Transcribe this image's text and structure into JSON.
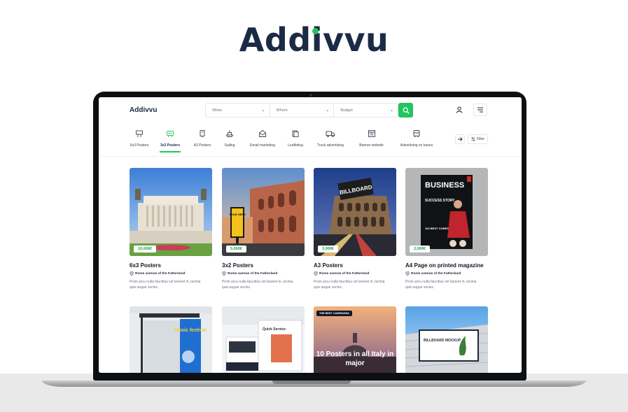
{
  "brand": {
    "name": "Addivvu"
  },
  "header": {
    "logo": "Addivvu",
    "search": {
      "when": "When",
      "where": "Where",
      "budget": "Budget"
    }
  },
  "categories": [
    {
      "label": "6x3 Posters",
      "icon": "billboard-icon"
    },
    {
      "label": "3x2 Posters",
      "icon": "poster-icon",
      "active": true
    },
    {
      "label": "A3 Posters",
      "icon": "a3-poster-icon"
    },
    {
      "label": "Sailing",
      "icon": "boat-icon"
    },
    {
      "label": "Email marketing",
      "icon": "email-icon"
    },
    {
      "label": "Leafleting",
      "icon": "leaflet-icon"
    },
    {
      "label": "Truck advertising",
      "icon": "truck-icon"
    },
    {
      "label": "Banner website",
      "icon": "banner-icon"
    },
    {
      "label": "Advertising on buses",
      "icon": "bus-icon"
    }
  ],
  "filter_label": "Filter",
  "listings": [
    {
      "price": "10,000€",
      "title": "6x3 Posters",
      "location": "Rome avenue of the Fatherland",
      "description": "Proin arcu nulla faucibus vel laoreet in, lacinia quis augue sectec."
    },
    {
      "price": "5,000€",
      "title": "3x2 Posters",
      "location": "Rome avenue of the Fatherland",
      "description": "Proin arcu nulla faucibus vel laoreet in, lacinia quis augue sectec."
    },
    {
      "price": "3,000€",
      "title": "A3 Posters",
      "location": "Rome avenue of the Fatherland",
      "description": "Proin arcu nulla faucibus vel laoreet in, lacinia quis augue sectec."
    },
    {
      "price": "2,000€",
      "title": "A4 Page on printed magazine",
      "location": "Rome avenue of the Fatherland",
      "description": "Proin arcu nulla faucibus vel laoreet in, lacinia quis augue sectec."
    }
  ],
  "promo": {
    "badge": "THE BEST CAMPAIGNS",
    "headline": "10 Posters in all Italy in major"
  },
  "image_text": {
    "billboard": "BILLBOARD",
    "your_here": "YOUR HERE",
    "magazine_title": "BUSINESS",
    "magazine_story": "SUCCESS STORY",
    "magazine_list": "100 BEST COMPANIES",
    "music": "Music festival",
    "quick": "Quick Service",
    "mockup": "BILLBOARD MOCKUP"
  },
  "colors": {
    "accent": "#22c55e",
    "navy": "#1b2a45",
    "price": "#16a34a"
  }
}
